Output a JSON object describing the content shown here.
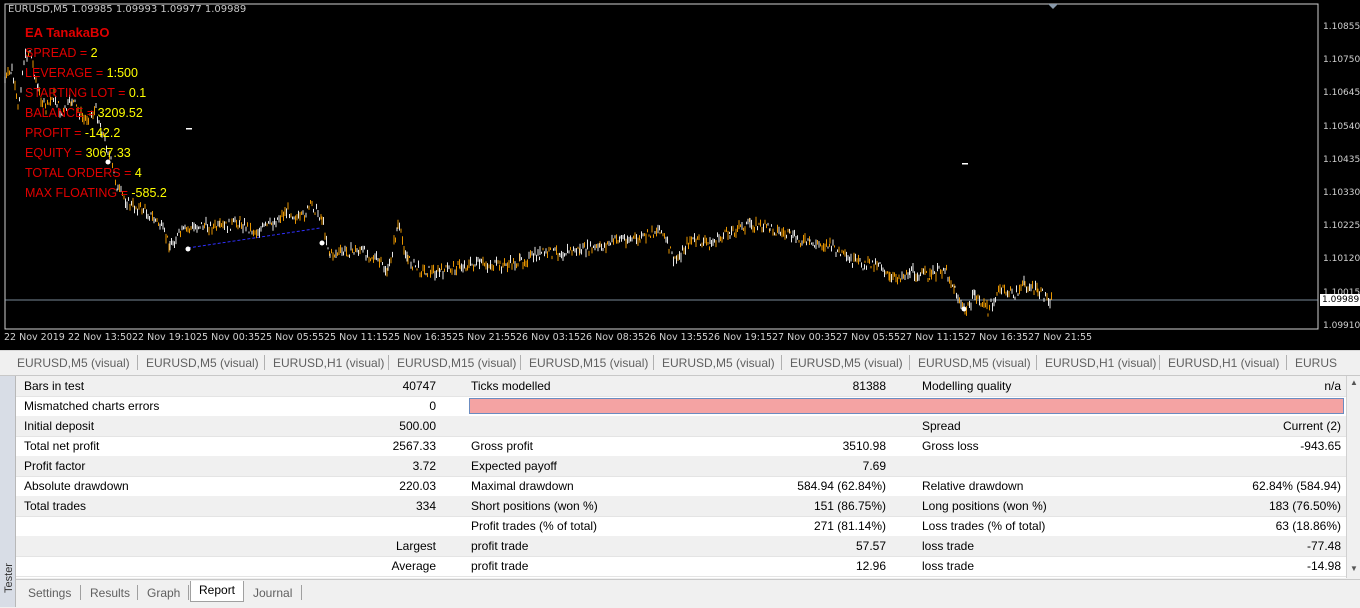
{
  "chart": {
    "symbol_header": "EURUSD,M5  1.09985 1.09993 1.09977 1.09989",
    "info_lines": [
      {
        "key": "EA TanakaBO",
        "value": ""
      },
      {
        "key": "SPREAD = ",
        "value": "2"
      },
      {
        "key": "LEVERAGE = ",
        "value": "1:500"
      },
      {
        "key": "STARTING LOT = ",
        "value": "0.1"
      },
      {
        "key": "BALANCE = ",
        "value": "3209.52"
      },
      {
        "key": "PROFIT = ",
        "value": "-142.2"
      },
      {
        "key": "EQUITY = ",
        "value": "3067.33"
      },
      {
        "key": "TOTAL ORDERS = ",
        "value": "4"
      },
      {
        "key": "MAX FLOATING = ",
        "value": "-585.2"
      }
    ],
    "price_ticks": [
      "1.10855",
      "1.10750",
      "1.10645",
      "1.10540",
      "1.10435",
      "1.10330",
      "1.10225",
      "1.10120",
      "1.10015",
      "1.09910"
    ],
    "current_price": "1.09989",
    "time_ticks": [
      "22 Nov 2019",
      "22 Nov 13:50",
      "22 Nov 19:10",
      "25 Nov 00:35",
      "25 Nov 05:55",
      "25 Nov 11:15",
      "25 Nov 16:35",
      "25 Nov 21:55",
      "26 Nov 03:15",
      "26 Nov 08:35",
      "26 Nov 13:55",
      "26 Nov 19:15",
      "27 Nov 00:35",
      "27 Nov 05:55",
      "27 Nov 11:15",
      "27 Nov 16:35",
      "27 Nov 21:55"
    ],
    "colors": {
      "background": "#000000",
      "candles": "#ffa500",
      "info_key": "#e00000",
      "info_value": "#ffff00"
    }
  },
  "chart_tabs": [
    "EURUSD,M5 (visual)",
    "EURUSD,M5 (visual)",
    "EURUSD,H1 (visual)",
    "EURUSD,M15 (visual)",
    "EURUSD,M15 (visual)",
    "EURUSD,M5 (visual)",
    "EURUSD,M5 (visual)",
    "EURUSD,M5 (visual)",
    "EURUSD,H1 (visual)",
    "EURUSD,H1 (visual)",
    "EURUS"
  ],
  "side_label": "Tester",
  "report": {
    "rows": [
      [
        "Bars in test",
        "40747",
        "Ticks modelled",
        "81388",
        "Modelling quality",
        "n/a"
      ],
      [
        "Mismatched charts errors",
        "0",
        "",
        "",
        "",
        ""
      ],
      [
        "Initial deposit",
        "500.00",
        "",
        "",
        "Spread",
        "Current (2)"
      ],
      [
        "Total net profit",
        "2567.33",
        "Gross profit",
        "3510.98",
        "Gross loss",
        "-943.65"
      ],
      [
        "Profit factor",
        "3.72",
        "Expected payoff",
        "7.69",
        "",
        ""
      ],
      [
        "Absolute drawdown",
        "220.03",
        "Maximal drawdown",
        "584.94 (62.84%)",
        "Relative drawdown",
        "62.84% (584.94)"
      ],
      [
        "Total trades",
        "334",
        "Short positions (won %)",
        "151 (86.75%)",
        "Long positions (won %)",
        "183 (76.50%)"
      ],
      [
        "",
        "",
        "Profit trades (% of total)",
        "271 (81.14%)",
        "Loss trades (% of total)",
        "63 (18.86%)"
      ],
      [
        "",
        "Largest",
        "profit trade",
        "57.57",
        "loss trade",
        "-77.48"
      ],
      [
        "",
        "Average",
        "profit trade",
        "12.96",
        "loss trade",
        "-14.98"
      ]
    ]
  },
  "bottom_tabs": [
    "Settings",
    "Results",
    "Graph",
    "Report",
    "Journal"
  ],
  "active_bottom_tab": "Report"
}
